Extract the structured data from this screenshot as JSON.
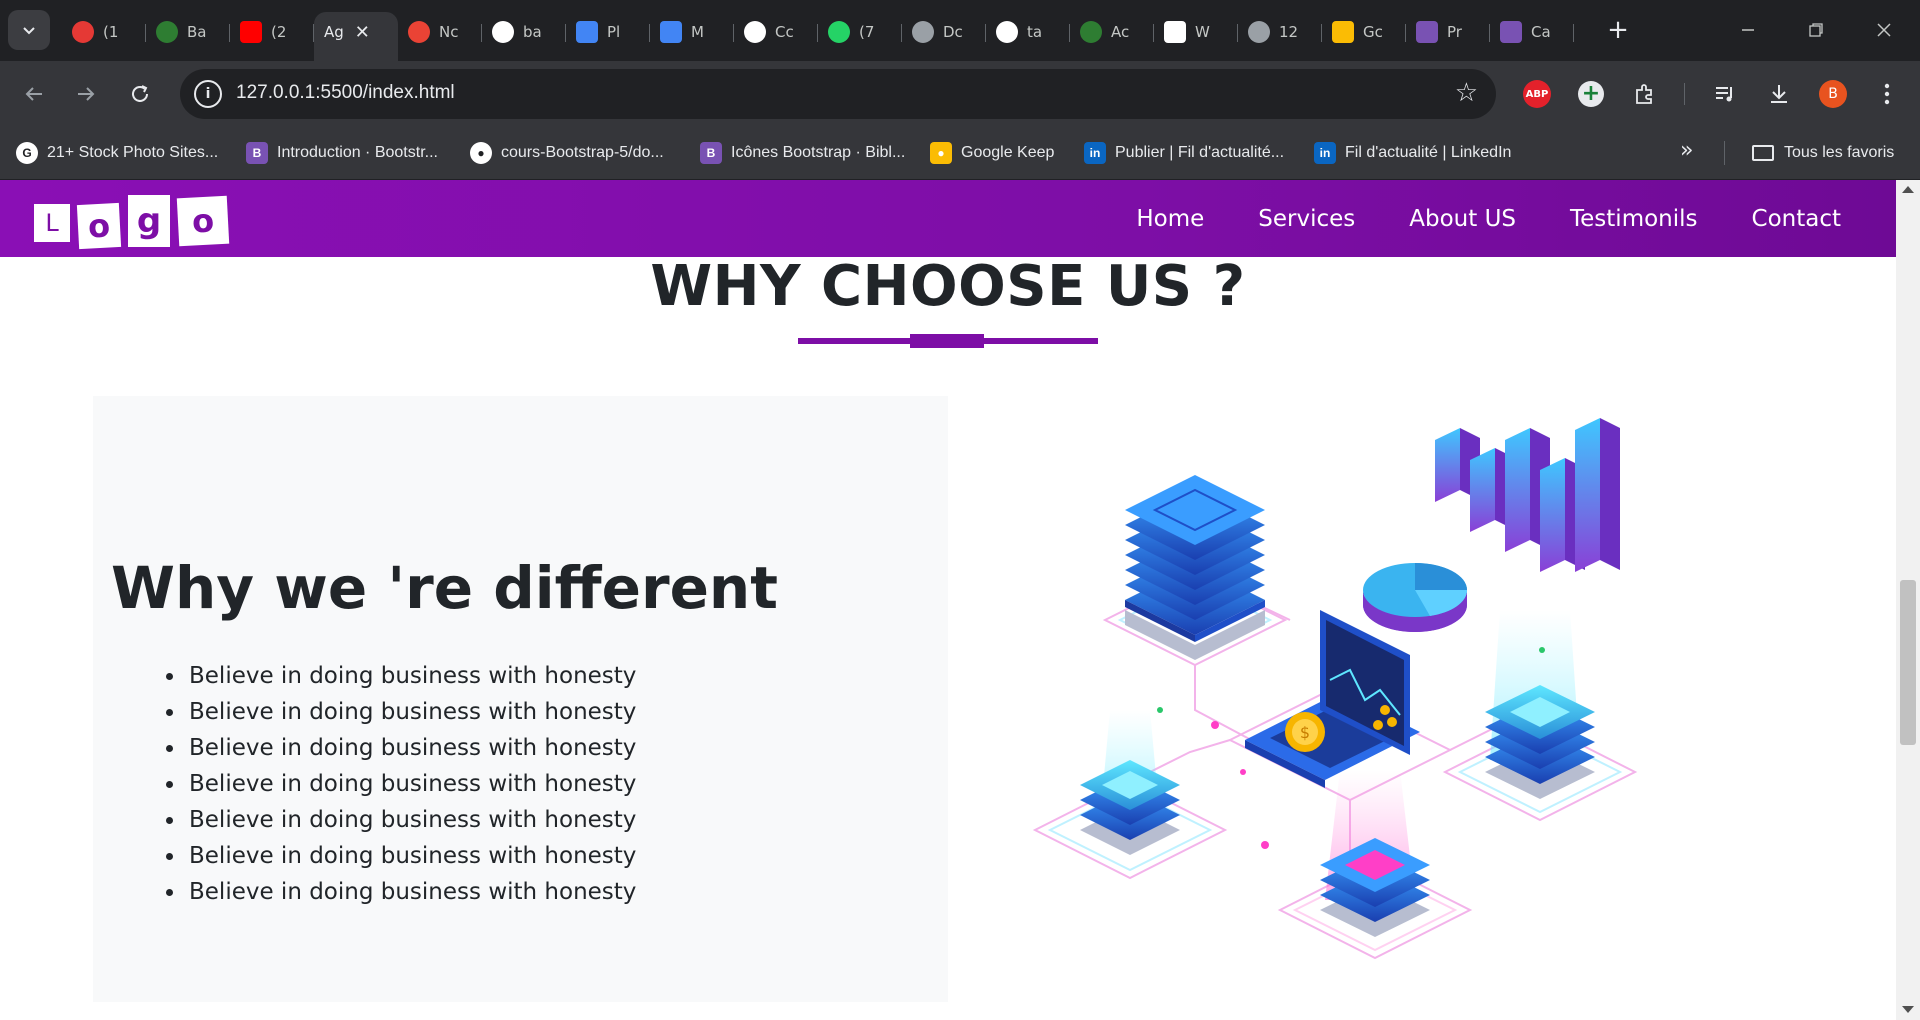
{
  "browser": {
    "tabs": [
      {
        "label": "(1",
        "icon": "gmail-inbox-icon",
        "color": "#e53935"
      },
      {
        "label": "Ba",
        "icon": "cursor-app-icon",
        "color": "#2e7d32"
      },
      {
        "label": "(2",
        "icon": "youtube-icon",
        "color": "#ff0000"
      },
      {
        "label": "Ag",
        "icon": "",
        "color": "",
        "active": true
      },
      {
        "label": "Nc",
        "icon": "gmail-icon",
        "color": "#ea4335"
      },
      {
        "label": "ba",
        "icon": "github-icon",
        "color": "#ffffff"
      },
      {
        "label": "Pl",
        "icon": "google-docs-icon",
        "color": "#4285f4"
      },
      {
        "label": "M",
        "icon": "google-docs-icon",
        "color": "#4285f4"
      },
      {
        "label": "Cc",
        "icon": "chat-icon",
        "color": "#ffffff"
      },
      {
        "label": "(7",
        "icon": "whatsapp-icon",
        "color": "#25d366"
      },
      {
        "label": "Dc",
        "icon": "globe-icon",
        "color": "#9aa0a6"
      },
      {
        "label": "ta",
        "icon": "github-icon",
        "color": "#ffffff"
      },
      {
        "label": "Ac",
        "icon": "cursor-app-icon",
        "color": "#2e7d32"
      },
      {
        "label": "W",
        "icon": "w3schools-icon",
        "color": "#ffffff"
      },
      {
        "label": "12",
        "icon": "globe-icon",
        "color": "#9aa0a6"
      },
      {
        "label": "Gc",
        "icon": "google-keep-icon",
        "color": "#fbbc04"
      },
      {
        "label": "Pr",
        "icon": "bootstrap-icon",
        "color": "#7952b3"
      },
      {
        "label": "Ca",
        "icon": "bootstrap-icon",
        "color": "#7952b3"
      }
    ],
    "tab_close_glyph": "✕",
    "new_tab_glyph": "+",
    "url": "127.0.0.1:5500/index.html",
    "bookmarks": [
      {
        "label": "21+ Stock Photo Sites...",
        "icon": "google-icon",
        "glyph": "G",
        "color": "#ffffff"
      },
      {
        "label": "Introduction · Bootstr...",
        "icon": "bootstrap-icon",
        "glyph": "B",
        "color": "#7952b3"
      },
      {
        "label": "cours-Bootstrap-5/do...",
        "icon": "github-icon",
        "glyph": "●",
        "color": "#ffffff"
      },
      {
        "label": "Icônes Bootstrap · Bibl...",
        "icon": "bootstrap-icon",
        "glyph": "B",
        "color": "#7952b3"
      },
      {
        "label": "Google Keep",
        "icon": "google-keep-icon",
        "glyph": "●",
        "color": "#fbbc04"
      },
      {
        "label": "Publier | Fil d'actualité...",
        "icon": "linkedin-icon",
        "glyph": "in",
        "color": "#0a66c2"
      },
      {
        "label": "Fil d'actualité | LinkedIn",
        "icon": "linkedin-icon",
        "glyph": "in",
        "color": "#0a66c2"
      }
    ],
    "bookmarks_folder": "Tous les favoris",
    "profile_initial": "B",
    "abp_label": "ABP"
  },
  "site": {
    "brand_color": "#7d0ea6",
    "logo_letters": [
      "L",
      "o",
      "g",
      "o"
    ],
    "nav": [
      "Home",
      "Services",
      "About US",
      "Testimonils",
      "Contact"
    ],
    "section_title": "WHY CHOOSE US ?",
    "card": {
      "heading": "Why we 're different",
      "items": [
        "Believe in doing business with honesty",
        "Believe in doing business with honesty",
        "Believe in doing business with honesty",
        "Believe in doing business with honesty",
        "Believe in doing business with honesty",
        "Believe in doing business with honesty",
        "Believe in doing business with honesty"
      ]
    },
    "illustration": "isometric-data-center-illustration"
  }
}
